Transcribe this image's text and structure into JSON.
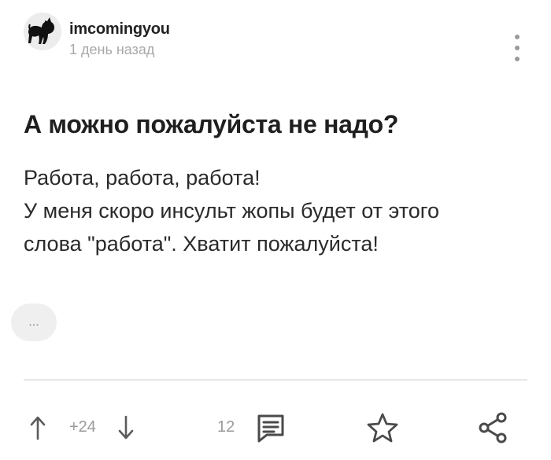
{
  "author": {
    "username": "imcomingyou",
    "timestamp": "1 день назад",
    "avatar_icon": "cat-avatar-icon"
  },
  "menu": {
    "icon": "more-vertical-icon"
  },
  "post": {
    "title": "А можно пожалуйста не надо?",
    "body_lines": [
      "Работа, работа, работа!",
      "У меня скоро инсульт жопы будет от этого",
      "слова \"работа\". Хватит пожалуйста!"
    ]
  },
  "expand": {
    "label": "..."
  },
  "actions": {
    "upvote_icon": "arrow-up-icon",
    "rating": "+24",
    "downvote_icon": "arrow-down-icon",
    "comments_count": "12",
    "comments_icon": "comment-icon",
    "save_icon": "star-icon",
    "share_icon": "share-icon"
  },
  "colors": {
    "text": "#222222",
    "muted": "#9a9a9a",
    "divider": "#e6e6e6",
    "icon": "#5b5b5b"
  }
}
